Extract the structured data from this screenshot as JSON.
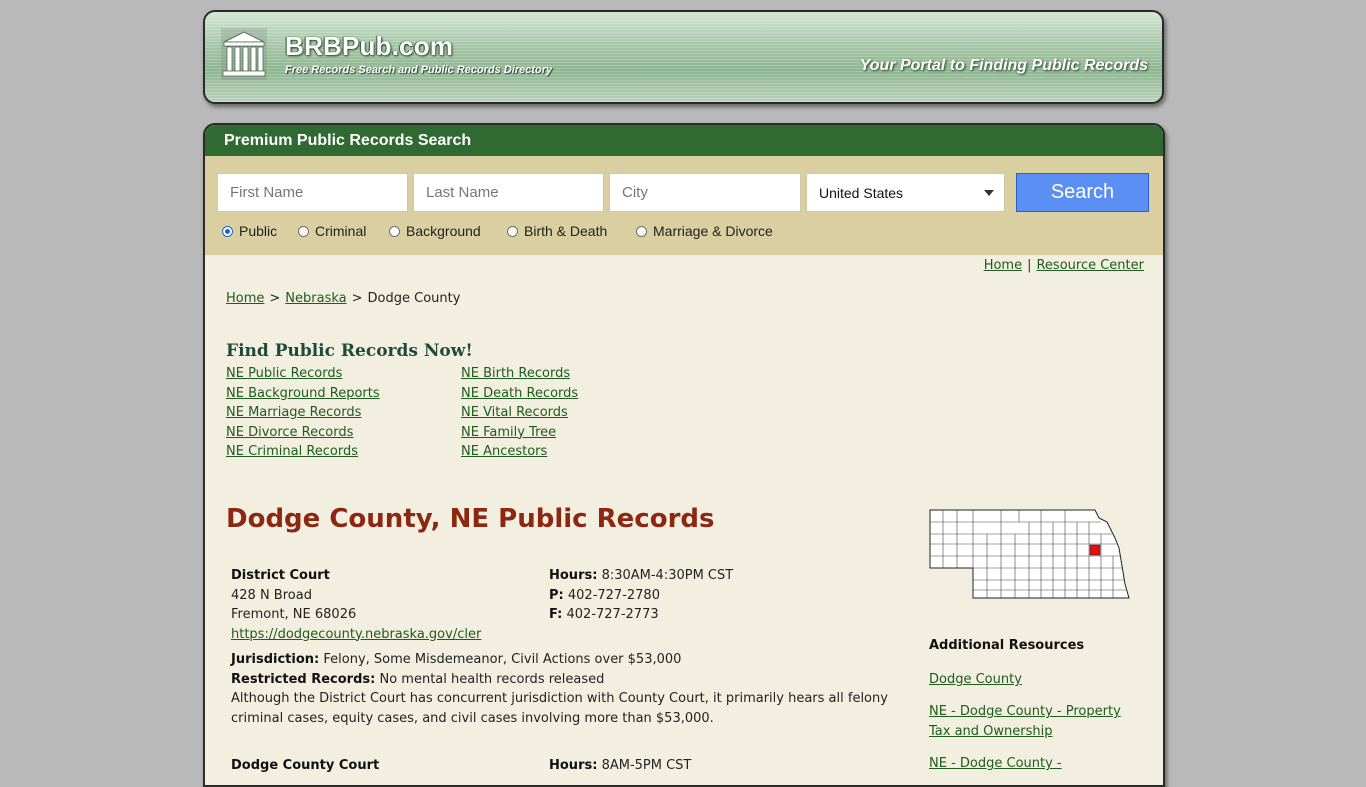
{
  "header": {
    "site_name": "BRBPub.com",
    "tagline": "Free Records Search and Public Records Directory",
    "slogan": "Your Portal to Finding Public Records"
  },
  "search": {
    "title": "Premium Public Records Search",
    "first_name_placeholder": "First Name",
    "last_name_placeholder": "Last Name",
    "city_placeholder": "City",
    "country_selected": "United States",
    "button_label": "Search",
    "record_types": [
      "Public",
      "Criminal",
      "Background",
      "Birth & Death",
      "Marriage & Divorce"
    ],
    "selected_type": "Public"
  },
  "top_links": {
    "home": "Home",
    "separator": "|",
    "resource_center": "Resource Center"
  },
  "breadcrumb": {
    "home": "Home",
    "state": "Nebraska",
    "current": "Dodge County",
    "separator": ">"
  },
  "find_records": {
    "heading": "Find Public Records Now!",
    "left_links": [
      "NE Public Records",
      "NE Background Reports",
      "NE Marriage Records",
      "NE Divorce Records",
      "NE Criminal Records"
    ],
    "right_links": [
      "NE Birth Records",
      "NE Death Records",
      "NE Vital Records",
      "NE Family Tree",
      "NE Ancestors"
    ]
  },
  "county": {
    "title": "Dodge County, NE Public Records",
    "offices": [
      {
        "name": "District Court",
        "address1": "428 N Broad",
        "address2": "Fremont, NE 68026",
        "url": "https://dodgecounty.nebraska.gov/cler",
        "hours_label": "Hours:",
        "hours": "8:30AM-4:30PM CST",
        "phone_label": "P:",
        "phone": "402-727-2780",
        "fax_label": "F:",
        "fax": "402-727-2773",
        "jurisdiction_label": "Jurisdiction:",
        "jurisdiction": "Felony, Some Misdemeanor, Civil Actions over $53,000",
        "restricted_label": "Restricted Records:",
        "restricted": "No mental health records released",
        "description": "Although the District Court has concurrent jurisdiction with County Court, it primarily hears all felony criminal cases, equity cases, and civil cases involving more than $53,000."
      },
      {
        "name": "Dodge County Court",
        "hours_label": "Hours:",
        "hours": "8AM-5PM CST"
      }
    ]
  },
  "sidebar": {
    "map_label": "Nebraska county map",
    "highlight_color": "#e31010",
    "additional_heading": "Additional Resources",
    "links": [
      "Dodge County",
      "NE - Dodge County - Property Tax and Ownership",
      "NE - Dodge County -"
    ]
  }
}
